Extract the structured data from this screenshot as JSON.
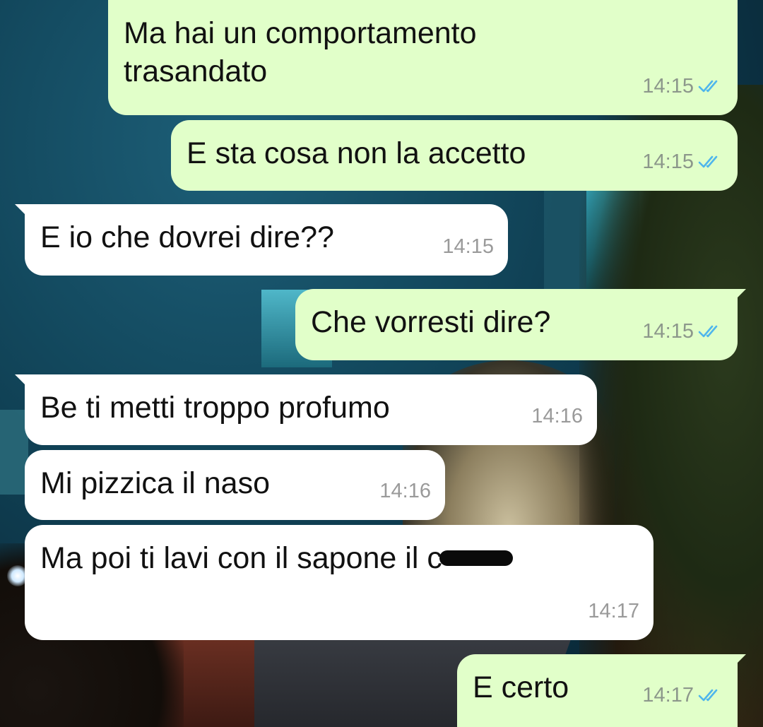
{
  "theme": {
    "outgoing_bubble_color": "#e1ffc9",
    "incoming_bubble_color": "#ffffff",
    "read_tick_color": "#4fb6ec"
  },
  "messages": [
    {
      "direction": "out",
      "text": "Ma hai un comportamento\ntrasandato",
      "time": "14:15",
      "status": "read-double-tick-icon"
    },
    {
      "direction": "out",
      "text": "E sta cosa non la accetto",
      "time": "14:15",
      "status": "read-double-tick-icon"
    },
    {
      "direction": "in",
      "text": "E io che dovrei dire??",
      "time": "14:15"
    },
    {
      "direction": "out",
      "text": "Che vorresti dire?",
      "time": "14:15",
      "status": "read-double-tick-icon"
    },
    {
      "direction": "in",
      "text": "Be ti metti troppo profumo",
      "time": "14:16"
    },
    {
      "direction": "in",
      "text": "Mi pizzica il naso",
      "time": "14:16"
    },
    {
      "direction": "in",
      "text": "Ma poi ti lavi con il sapone il c",
      "time": "14:17",
      "redacted": true
    },
    {
      "direction": "out",
      "text": "E certo",
      "time": "14:17",
      "status": "read-double-tick-icon"
    }
  ]
}
